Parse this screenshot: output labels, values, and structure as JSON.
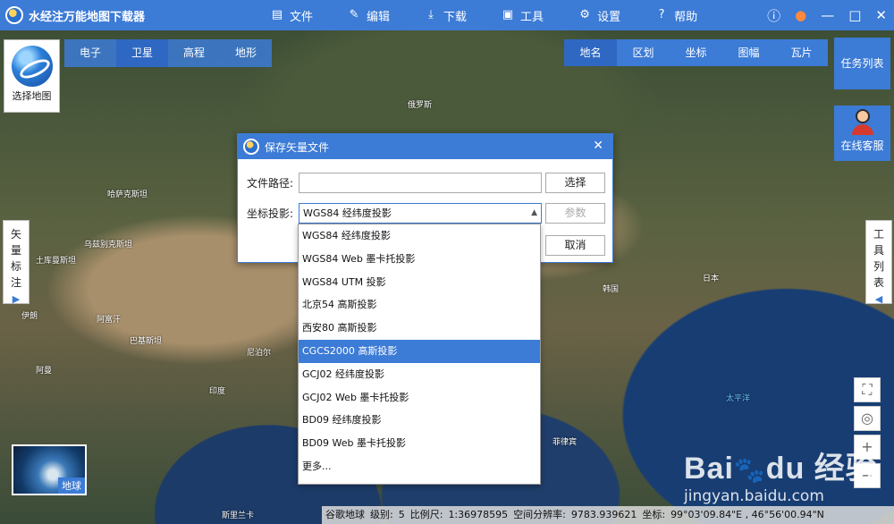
{
  "app": {
    "title": "水经注万能地图下载器"
  },
  "menu": [
    {
      "label": "文件",
      "icon": "folder-icon"
    },
    {
      "label": "编辑",
      "icon": "edit-icon"
    },
    {
      "label": "下载",
      "icon": "download-icon"
    },
    {
      "label": "工具",
      "icon": "toolbox-icon"
    },
    {
      "label": "设置",
      "icon": "gear-icon"
    },
    {
      "label": "帮助",
      "icon": "help-icon"
    }
  ],
  "map_selector": {
    "label": "选择地图"
  },
  "layer_tabs": [
    "电子",
    "卫星",
    "高程",
    "地形"
  ],
  "search_tabs": [
    "地名",
    "区划",
    "坐标",
    "图幅",
    "瓦片"
  ],
  "task_list": "任务列表",
  "online_service": "在线客服",
  "vector_tab": "矢量标注",
  "tools_tab": "工具列表",
  "earth_thumb": "地球",
  "map_labels": [
    {
      "text": "俄罗斯",
      "sea": false
    },
    {
      "text": "哈萨克斯坦",
      "sea": false
    },
    {
      "text": "乌兹别克斯坦",
      "sea": false
    },
    {
      "text": "土库曼斯坦",
      "sea": false
    },
    {
      "text": "伊朗",
      "sea": false
    },
    {
      "text": "阿富汗",
      "sea": false
    },
    {
      "text": "巴基斯坦",
      "sea": false
    },
    {
      "text": "印度",
      "sea": false
    },
    {
      "text": "尼泊尔",
      "sea": false
    },
    {
      "text": "韩国",
      "sea": false
    },
    {
      "text": "日本",
      "sea": false
    },
    {
      "text": "太平洋",
      "sea": true
    },
    {
      "text": "菲律宾",
      "sea": false
    },
    {
      "text": "阿曼",
      "sea": false
    },
    {
      "text": "斯里兰卡",
      "sea": false
    }
  ],
  "dialog": {
    "title": "保存矢量文件",
    "path_label": "文件路径:",
    "path_value": "",
    "choose_button": "选择",
    "projection_label": "坐标投影:",
    "projection_value": "WGS84 经纬度投影",
    "params_button": "参数",
    "cancel_button": "取消"
  },
  "projection_options": [
    "WGS84 经纬度投影",
    "WGS84 Web 墨卡托投影",
    "WGS84 UTM 投影",
    "北京54 高斯投影",
    "西安80 高斯投影",
    "CGCS2000 高斯投影",
    "GCJ02 经纬度投影",
    "GCJ02 Web 墨卡托投影",
    "BD09 经纬度投影",
    "BD09 Web 墨卡托投影",
    "更多..."
  ],
  "selected_projection_index": 5,
  "status": {
    "source": "谷歌地球",
    "level_label": "级别:",
    "level": "5",
    "scale_label": "比例尺:",
    "scale": "1:36978595",
    "resolution_label": "空间分辨率:",
    "resolution": "9783.939621",
    "coord_label": "坐标:",
    "coord": "99°03'09.84\"E , 46°56'00.94\"N"
  },
  "watermark": {
    "logo": "Bai du 经验",
    "url": "jingyan.baidu.com"
  },
  "colors": {
    "accent": "#3c7bd6",
    "selected": "#3c7bd6"
  }
}
